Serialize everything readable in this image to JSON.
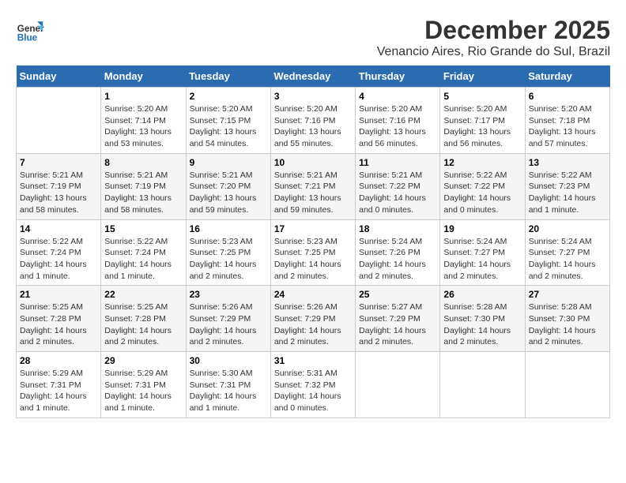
{
  "header": {
    "logo_general": "General",
    "logo_blue": "Blue",
    "month_title": "December 2025",
    "location": "Venancio Aires, Rio Grande do Sul, Brazil"
  },
  "weekdays": [
    "Sunday",
    "Monday",
    "Tuesday",
    "Wednesday",
    "Thursday",
    "Friday",
    "Saturday"
  ],
  "weeks": [
    [
      {
        "day": "",
        "info": ""
      },
      {
        "day": "1",
        "info": "Sunrise: 5:20 AM\nSunset: 7:14 PM\nDaylight: 13 hours\nand 53 minutes."
      },
      {
        "day": "2",
        "info": "Sunrise: 5:20 AM\nSunset: 7:15 PM\nDaylight: 13 hours\nand 54 minutes."
      },
      {
        "day": "3",
        "info": "Sunrise: 5:20 AM\nSunset: 7:16 PM\nDaylight: 13 hours\nand 55 minutes."
      },
      {
        "day": "4",
        "info": "Sunrise: 5:20 AM\nSunset: 7:16 PM\nDaylight: 13 hours\nand 56 minutes."
      },
      {
        "day": "5",
        "info": "Sunrise: 5:20 AM\nSunset: 7:17 PM\nDaylight: 13 hours\nand 56 minutes."
      },
      {
        "day": "6",
        "info": "Sunrise: 5:20 AM\nSunset: 7:18 PM\nDaylight: 13 hours\nand 57 minutes."
      }
    ],
    [
      {
        "day": "7",
        "info": "Sunrise: 5:21 AM\nSunset: 7:19 PM\nDaylight: 13 hours\nand 58 minutes."
      },
      {
        "day": "8",
        "info": "Sunrise: 5:21 AM\nSunset: 7:19 PM\nDaylight: 13 hours\nand 58 minutes."
      },
      {
        "day": "9",
        "info": "Sunrise: 5:21 AM\nSunset: 7:20 PM\nDaylight: 13 hours\nand 59 minutes."
      },
      {
        "day": "10",
        "info": "Sunrise: 5:21 AM\nSunset: 7:21 PM\nDaylight: 13 hours\nand 59 minutes."
      },
      {
        "day": "11",
        "info": "Sunrise: 5:21 AM\nSunset: 7:22 PM\nDaylight: 14 hours\nand 0 minutes."
      },
      {
        "day": "12",
        "info": "Sunrise: 5:22 AM\nSunset: 7:22 PM\nDaylight: 14 hours\nand 0 minutes."
      },
      {
        "day": "13",
        "info": "Sunrise: 5:22 AM\nSunset: 7:23 PM\nDaylight: 14 hours\nand 1 minute."
      }
    ],
    [
      {
        "day": "14",
        "info": "Sunrise: 5:22 AM\nSunset: 7:24 PM\nDaylight: 14 hours\nand 1 minute."
      },
      {
        "day": "15",
        "info": "Sunrise: 5:22 AM\nSunset: 7:24 PM\nDaylight: 14 hours\nand 1 minute."
      },
      {
        "day": "16",
        "info": "Sunrise: 5:23 AM\nSunset: 7:25 PM\nDaylight: 14 hours\nand 2 minutes."
      },
      {
        "day": "17",
        "info": "Sunrise: 5:23 AM\nSunset: 7:25 PM\nDaylight: 14 hours\nand 2 minutes."
      },
      {
        "day": "18",
        "info": "Sunrise: 5:24 AM\nSunset: 7:26 PM\nDaylight: 14 hours\nand 2 minutes."
      },
      {
        "day": "19",
        "info": "Sunrise: 5:24 AM\nSunset: 7:27 PM\nDaylight: 14 hours\nand 2 minutes."
      },
      {
        "day": "20",
        "info": "Sunrise: 5:24 AM\nSunset: 7:27 PM\nDaylight: 14 hours\nand 2 minutes."
      }
    ],
    [
      {
        "day": "21",
        "info": "Sunrise: 5:25 AM\nSunset: 7:28 PM\nDaylight: 14 hours\nand 2 minutes."
      },
      {
        "day": "22",
        "info": "Sunrise: 5:25 AM\nSunset: 7:28 PM\nDaylight: 14 hours\nand 2 minutes."
      },
      {
        "day": "23",
        "info": "Sunrise: 5:26 AM\nSunset: 7:29 PM\nDaylight: 14 hours\nand 2 minutes."
      },
      {
        "day": "24",
        "info": "Sunrise: 5:26 AM\nSunset: 7:29 PM\nDaylight: 14 hours\nand 2 minutes."
      },
      {
        "day": "25",
        "info": "Sunrise: 5:27 AM\nSunset: 7:29 PM\nDaylight: 14 hours\nand 2 minutes."
      },
      {
        "day": "26",
        "info": "Sunrise: 5:28 AM\nSunset: 7:30 PM\nDaylight: 14 hours\nand 2 minutes."
      },
      {
        "day": "27",
        "info": "Sunrise: 5:28 AM\nSunset: 7:30 PM\nDaylight: 14 hours\nand 2 minutes."
      }
    ],
    [
      {
        "day": "28",
        "info": "Sunrise: 5:29 AM\nSunset: 7:31 PM\nDaylight: 14 hours\nand 1 minute."
      },
      {
        "day": "29",
        "info": "Sunrise: 5:29 AM\nSunset: 7:31 PM\nDaylight: 14 hours\nand 1 minute."
      },
      {
        "day": "30",
        "info": "Sunrise: 5:30 AM\nSunset: 7:31 PM\nDaylight: 14 hours\nand 1 minute."
      },
      {
        "day": "31",
        "info": "Sunrise: 5:31 AM\nSunset: 7:32 PM\nDaylight: 14 hours\nand 0 minutes."
      },
      {
        "day": "",
        "info": ""
      },
      {
        "day": "",
        "info": ""
      },
      {
        "day": "",
        "info": ""
      }
    ]
  ]
}
